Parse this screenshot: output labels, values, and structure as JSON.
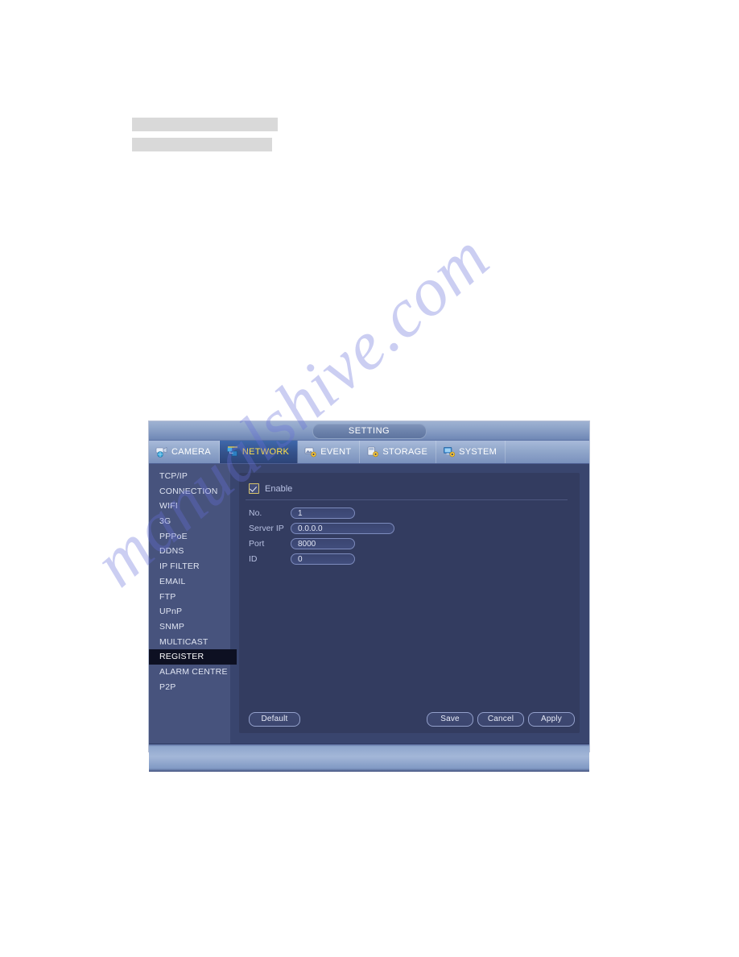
{
  "document": {
    "redacted_bars": [
      "",
      ""
    ]
  },
  "watermark": {
    "text": "manualshive.com"
  },
  "dialog": {
    "title": "SETTING",
    "tabs": [
      {
        "label": "CAMERA",
        "icon": "camera-globe-icon",
        "active": false
      },
      {
        "label": "NETWORK",
        "icon": "network-icon",
        "active": true
      },
      {
        "label": "EVENT",
        "icon": "event-gear-icon",
        "active": false
      },
      {
        "label": "STORAGE",
        "icon": "storage-gear-icon",
        "active": false
      },
      {
        "label": "SYSTEM",
        "icon": "system-gear-icon",
        "active": false
      }
    ],
    "sidebar": {
      "items": [
        {
          "label": "TCP/IP",
          "selected": false
        },
        {
          "label": "CONNECTION",
          "selected": false
        },
        {
          "label": "WIFI",
          "selected": false
        },
        {
          "label": "3G",
          "selected": false
        },
        {
          "label": "PPPoE",
          "selected": false
        },
        {
          "label": "DDNS",
          "selected": false
        },
        {
          "label": "IP FILTER",
          "selected": false
        },
        {
          "label": "EMAIL",
          "selected": false
        },
        {
          "label": "FTP",
          "selected": false
        },
        {
          "label": "UPnP",
          "selected": false
        },
        {
          "label": "SNMP",
          "selected": false
        },
        {
          "label": "MULTICAST",
          "selected": false
        },
        {
          "label": "REGISTER",
          "selected": true
        },
        {
          "label": "ALARM CENTRE",
          "selected": false
        },
        {
          "label": "P2P",
          "selected": false
        }
      ]
    },
    "form": {
      "enable": {
        "label": "Enable",
        "checked": true
      },
      "fields": [
        {
          "label": "No.",
          "value": "1",
          "type": "select"
        },
        {
          "label": "Server IP",
          "value": "0.0.0.0",
          "type": "text"
        },
        {
          "label": "Port",
          "value": "8000",
          "type": "text"
        },
        {
          "label": "ID",
          "value": "0",
          "type": "text"
        }
      ]
    },
    "buttons": {
      "default": "Default",
      "save": "Save",
      "cancel": "Cancel",
      "apply": "Apply"
    },
    "colors": {
      "accent_active_tab_text": "#ffe04a",
      "panel_bg": "#333c60",
      "sidebar_bg": "#47537d",
      "selected_item_bg": "#0d1022",
      "checkbox_border": "#d8c46a"
    }
  }
}
